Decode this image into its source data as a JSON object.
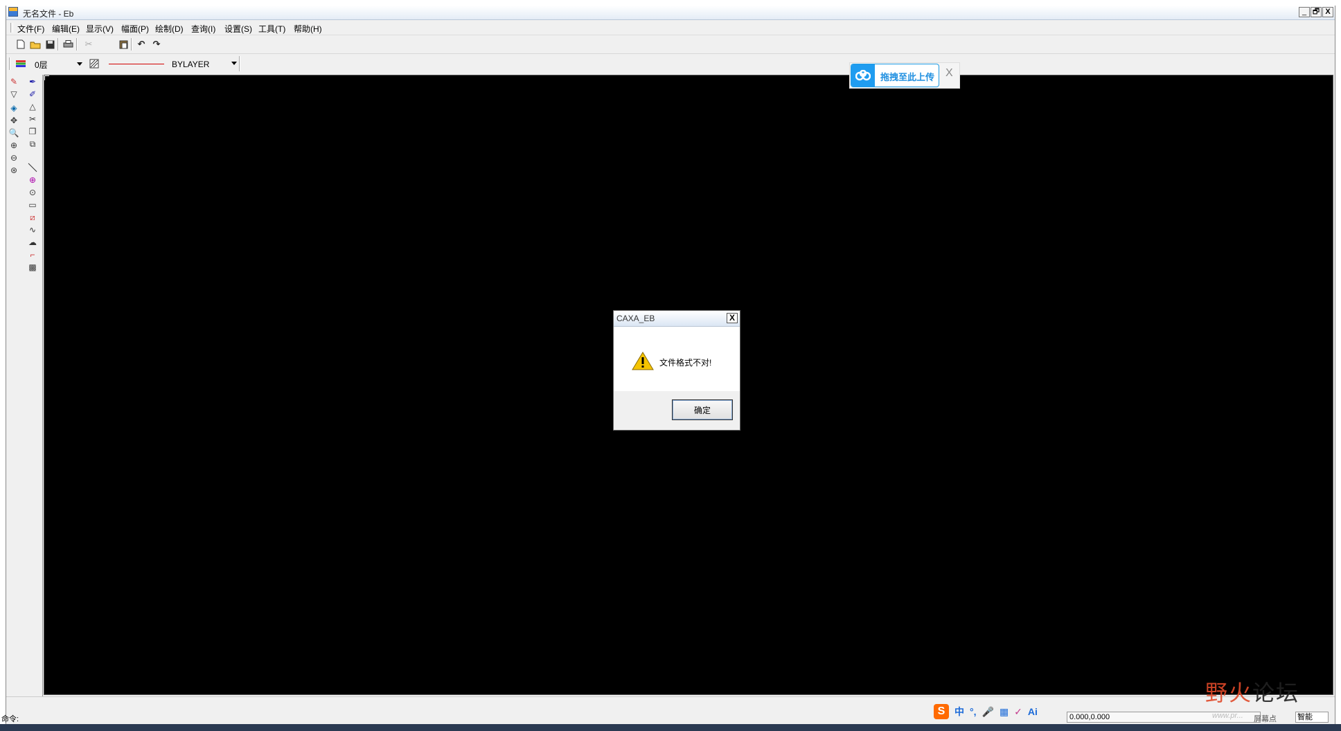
{
  "window": {
    "title": "无名文件 - Eb",
    "controls": {
      "minimize": "_",
      "restore": "🗗",
      "close": "X"
    }
  },
  "menu": {
    "items": [
      "文件(F)",
      "编辑(E)",
      "显示(V)",
      "幅面(P)",
      "绘制(D)",
      "查询(I)",
      "设置(S)",
      "工具(T)",
      "帮助(H)"
    ]
  },
  "toolbar": {
    "layer_value": "0层",
    "linetype_value": "BYLAYER",
    "linetype_color": "#d00000"
  },
  "upload_widget": {
    "label": "拖拽至此上传",
    "close": "X",
    "accent": "#1f9cf0"
  },
  "dialog": {
    "title": "CAXA_EB",
    "close": "X",
    "message": "文件格式不对!",
    "ok_label": "确定"
  },
  "command": {
    "prompt": "命令:"
  },
  "status": {
    "ime_items": [
      "中",
      "°,",
      "🎤",
      "▦",
      "✓",
      "Ai"
    ],
    "coordinates": "0.000,0.000",
    "screen_point": "屏幕点",
    "smart": "智能"
  },
  "watermark": {
    "text_red": "野火",
    "text_black": "论坛",
    "url": "www.pr..."
  }
}
